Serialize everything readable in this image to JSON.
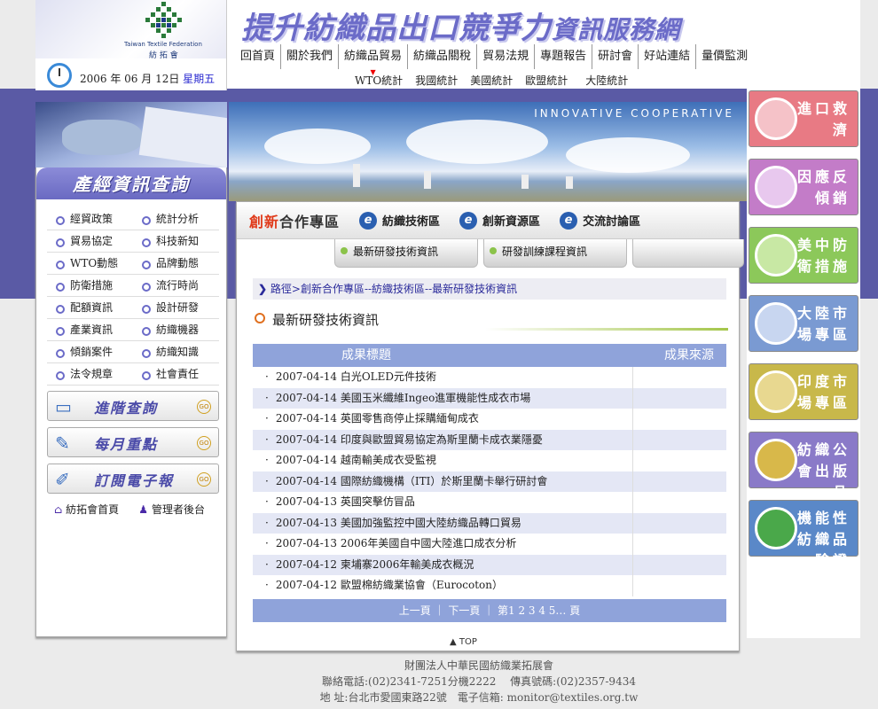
{
  "site": {
    "title_big": "提升紡織品出口競爭力",
    "title_small": "資訊服務網",
    "logo_en": "Taiwan Textile Federation",
    "logo_cn": "紡 拓 會",
    "date": "2006 年 06 月 12日",
    "weekday": "星期五"
  },
  "nav": {
    "items": [
      "回首頁",
      "關於我們",
      "紡織品貿易",
      "紡織品關稅",
      "貿易法規",
      "專題報告",
      "研討會",
      "好站連結",
      "量價監測"
    ],
    "sub": [
      "WTO統計",
      "我國統計",
      "美國統計",
      "歐盟統計",
      "大陸統計"
    ]
  },
  "left": {
    "panel_title": "產經資訊查詢",
    "links": [
      [
        "經貿政策",
        "統計分析"
      ],
      [
        "貿易協定",
        "科技新知"
      ],
      [
        "WTO動態",
        "品牌動態"
      ],
      [
        "防衛措施",
        "流行時尚"
      ],
      [
        "配額資訊",
        "設計研發"
      ],
      [
        "產業資訊",
        "紡織機器"
      ],
      [
        "傾銷案件",
        "紡織知識"
      ],
      [
        "法令規章",
        "社會責任"
      ]
    ],
    "buttons": [
      "進階查詢",
      "每月重點",
      "訂閱電子報"
    ],
    "go": "GO",
    "home": "紡拓會首頁",
    "admin": "管理者後台"
  },
  "banner": {
    "slogan": "INNOVATIVE COOPERATIVE"
  },
  "content": {
    "main_tab_red": "創新",
    "main_tab": "合作專區",
    "tabs": [
      "紡織技術區",
      "創新資源區",
      "交流討論區"
    ],
    "subtabs": [
      "最新研發技術資訊",
      "研發訓練課程資訊"
    ],
    "breadcrumb": "路徑>創新合作專區--紡織技術區--最新研發技術資訊",
    "section_title": "最新研發技術資訊",
    "col_title": "成果標題",
    "col_source": "成果來源",
    "rows": [
      "2007-04-14 白光OLED元件技術",
      "2007-04-14 美國玉米纖維Ingeo進軍機能性成衣市場",
      "2007-04-14 英國零售商停止採購緬甸成衣",
      "2007-04-14 印度與歐盟貿易協定為斯里蘭卡成衣業隱憂",
      "2007-04-14 越南輸美成衣受監視",
      "2007-04-14 國際紡織機構（ITI）於斯里蘭卡舉行研討會",
      "2007-04-13 英國突擊仿冒品",
      "2007-04-13 美國加強監控中國大陸紡織品轉口貿易",
      "2007-04-13 2006年美國自中國大陸進口成衣分析",
      "2007-04-12 柬埔寨2006年輸美成衣概況",
      "2007-04-12 歐盟棉紡織業協會（Eurocoton）"
    ],
    "pager": "上一頁 ｜ 下一頁 ｜ 第1 2 3 4 5… 頁",
    "top": "▲ TOP"
  },
  "right": {
    "buttons": [
      {
        "label": "進口救濟",
        "color": "#e87a84",
        "pic": "#f5c2c8"
      },
      {
        "label": "因應反傾銷",
        "color": "#c37cc8",
        "pic": "#e8c8ee"
      },
      {
        "label": "美中防衛措施",
        "color": "#8cc85a",
        "pic": "#c8e8a4"
      },
      {
        "label": "大陸市場專區",
        "color": "#7a9ad2",
        "pic": "#c8d6f0"
      },
      {
        "label": "印度市場專區",
        "color": "#c8b84a",
        "pic": "#e8d890"
      },
      {
        "label": "紡織公會出版品",
        "color": "#8a7ac8",
        "pic": "#d8b84a"
      },
      {
        "label": "機能性紡織品驗證",
        "color": "#5a88c8",
        "pic": "#4aa84a"
      }
    ]
  },
  "footer": {
    "org": "財團法人中華民國紡織業拓展會",
    "phone": "聯絡電話:(02)2341-7251分機2222　 傳真號碼:(02)2357-9434",
    "address": "地 址:台北市愛國東路22號　電子信箱: monitor@textiles.org.tw"
  }
}
